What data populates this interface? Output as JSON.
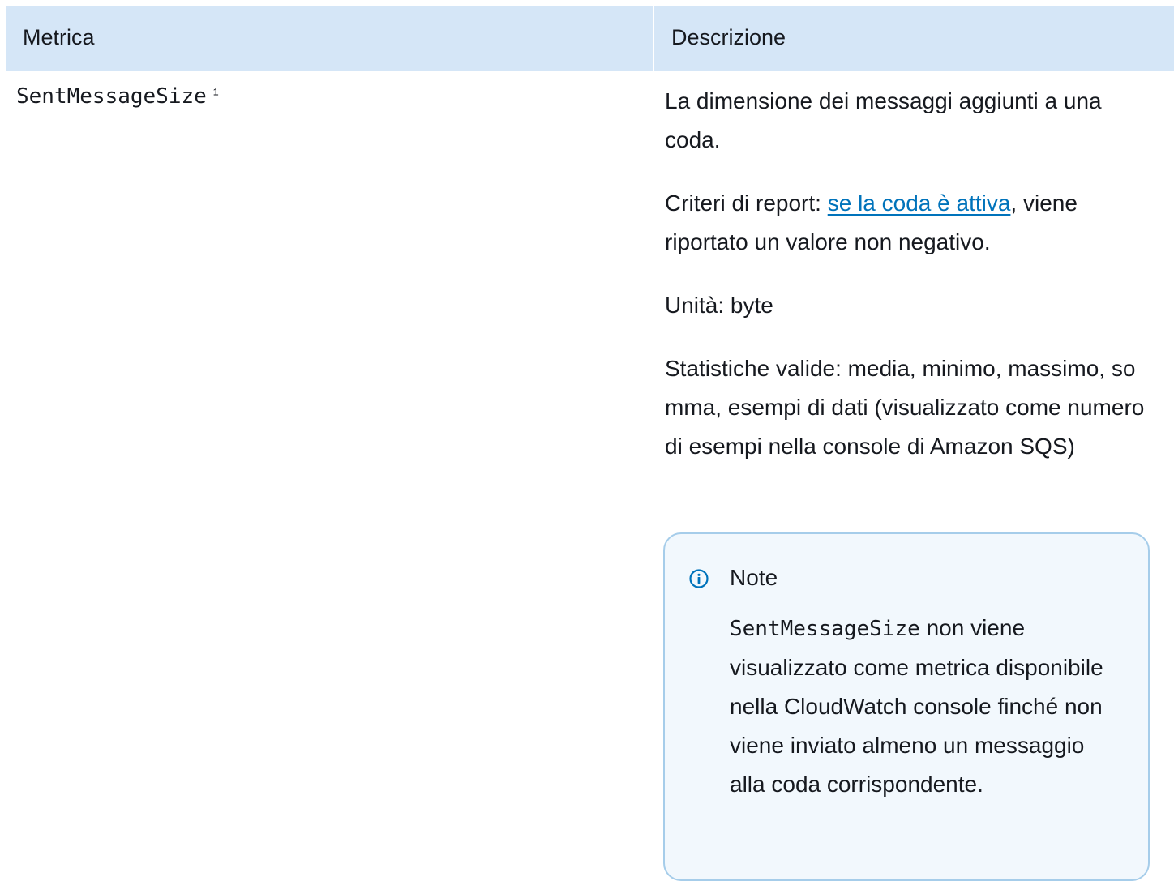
{
  "table": {
    "headers": {
      "metric": "Metrica",
      "description": "Descrizione"
    },
    "row": {
      "metric_name": "SentMessageSize",
      "metric_footnote": "¹",
      "description": {
        "summary": "La dimensione dei messaggi aggiunti a una coda.",
        "criteria_prefix": "Criteri di report: ",
        "criteria_link": "se la coda è attiva",
        "criteria_suffix": ", viene riportato un valore non negativo.",
        "units": "Unità: byte",
        "statistics": "Statistiche valide: media, minimo, massimo, somma, esempi di dati (visualizzato come numero di esempi nella console di Amazon SQS)"
      },
      "note": {
        "title": "Note",
        "code": "SentMessageSize",
        "text": " non viene visualizzato come metrica disponibile nella CloudWatch console finché non viene inviato almeno un messaggio alla coda corrispondente."
      }
    }
  },
  "colors": {
    "header_bg": "#d5e6f7",
    "link": "#0073bb",
    "note_border": "#a6cdea",
    "note_bg": "#f2f8fd",
    "info_icon": "#0073bb"
  },
  "icons": {
    "note": "info-icon"
  }
}
